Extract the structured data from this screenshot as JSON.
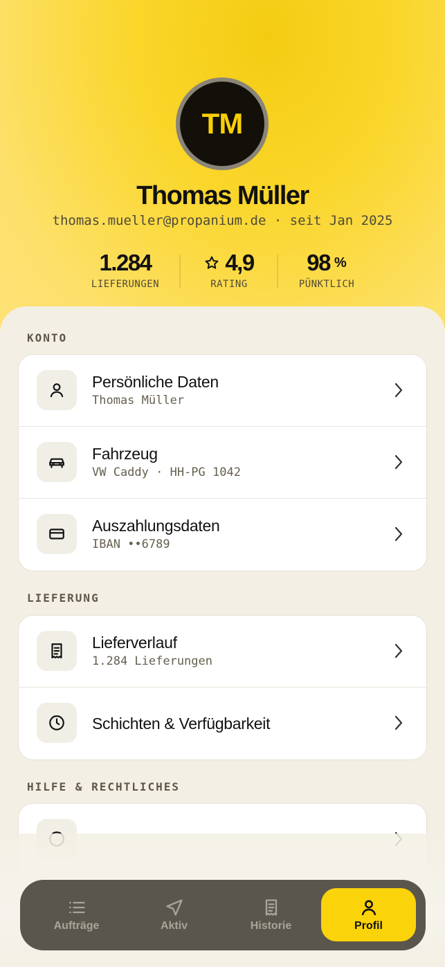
{
  "profile": {
    "initials": "TM",
    "name": "Thomas Müller",
    "subtitle": "thomas.mueller@propanium.de · seit Jan 2025"
  },
  "stats": [
    {
      "value": "1.284",
      "unit": "",
      "label": "LIEFERUNGEN"
    },
    {
      "value": "4,9",
      "unit": "",
      "label": "RATING",
      "icon": "star-icon"
    },
    {
      "value": "98",
      "unit": "%",
      "label": "PÜNKTLICH"
    }
  ],
  "sections": {
    "konto": {
      "title": "KONTO",
      "items": [
        {
          "title": "Persönliche Daten",
          "sub": "Thomas Müller",
          "icon": "user-icon"
        },
        {
          "title": "Fahrzeug",
          "sub": "VW Caddy · HH-PG 1042",
          "icon": "car-icon"
        },
        {
          "title": "Auszahlungsdaten",
          "sub": "IBAN ••6789",
          "icon": "credit-card-icon"
        }
      ]
    },
    "lieferung": {
      "title": "LIEFERUNG",
      "items": [
        {
          "title": "Lieferverlauf",
          "sub": "1.284 Lieferungen",
          "icon": "receipt-icon"
        },
        {
          "title": "Schichten & Verfügbarkeit",
          "sub": "",
          "icon": "clock-icon"
        }
      ]
    },
    "hilfe": {
      "title": "HILFE & RECHTLICHES"
    }
  },
  "nav": [
    {
      "label": "Aufträge",
      "icon": "list-icon",
      "active": false
    },
    {
      "label": "Aktiv",
      "icon": "navigation-icon",
      "active": false
    },
    {
      "label": "Historie",
      "icon": "receipt-icon",
      "active": false
    },
    {
      "label": "Profil",
      "icon": "user-icon",
      "active": true
    }
  ],
  "colors": {
    "accent": "#fbd30b",
    "nav_bg": "#5a564d",
    "background": "#f3efe4"
  }
}
